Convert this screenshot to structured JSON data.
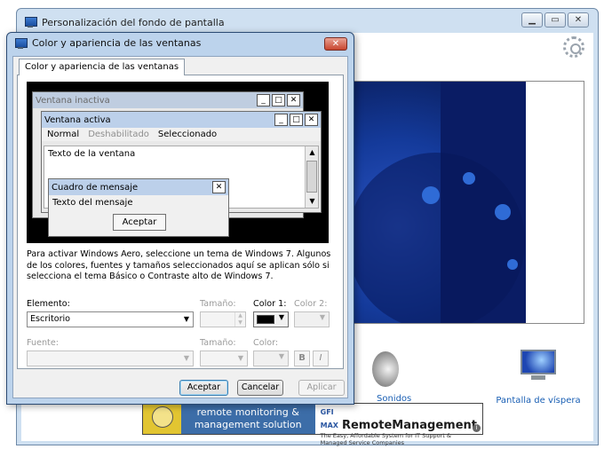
{
  "background_window": {
    "title": "Personalización del fondo de pantalla",
    "controls": {
      "minimize": "▁",
      "maximize": "▭",
      "close": "✕"
    },
    "items": [
      {
        "label": "Sonidos"
      },
      {
        "label": "Pantalla de víspera"
      }
    ],
    "banner": {
      "left_text": "remote monitoring &",
      "left_text2": "management solution",
      "brand_prefix": "GFI MAX",
      "brand": "RemoteManagement",
      "tagline": "The Easy, Affordable System for IT Support & Managed Service Companies",
      "info": "i"
    }
  },
  "dialog": {
    "title": "Color y apariencia de las ventanas",
    "close": "✕",
    "tab": "Color y apariencia de las ventanas",
    "preview": {
      "inactive_title": "Ventana inactiva",
      "active_title": "Ventana activa",
      "menu": [
        "Normal",
        "Deshabilitado",
        "Seleccionado"
      ],
      "window_text": "Texto de la ventana",
      "msgbox_title": "Cuadro de mensaje",
      "msgbox_text": "Texto del mensaje",
      "msgbox_ok": "Aceptar",
      "btn_min": "_",
      "btn_max": "□",
      "btn_close": "✕"
    },
    "hint": "Para activar Windows Aero, seleccione un tema de Windows 7. Algunos de los colores, fuentes y tamaños seleccionados aquí se aplican sólo si selecciona el tema Básico o Contraste alto de Windows 7.",
    "element": {
      "label": "Elemento:",
      "value": "Escritorio"
    },
    "size": {
      "label": "Tamaño:"
    },
    "color1": {
      "label": "Color 1:",
      "value": "#000000"
    },
    "color2": {
      "label": "Color 2:"
    },
    "font": {
      "label": "Fuente:"
    },
    "font_size": {
      "label": "Tamaño:"
    },
    "font_color": {
      "label": "Color:"
    },
    "bold": "B",
    "italic": "I",
    "buttons": {
      "ok": "Aceptar",
      "cancel": "Cancelar",
      "apply": "Aplicar"
    }
  }
}
